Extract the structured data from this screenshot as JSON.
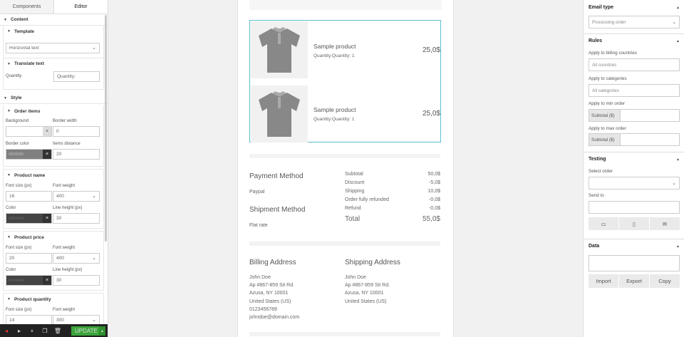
{
  "left_panel": {
    "tabs": [
      "Components",
      "Editor"
    ],
    "content_label": "Content",
    "template_label": "Template",
    "template_value": "Horizontal text",
    "translate_label": "Translate text",
    "quantity_label": "Quantity",
    "quantity_placeholder": "Quantity:",
    "style_label": "Style",
    "order_items": {
      "title": "Order items",
      "background_label": "Background",
      "border_width_label": "Border width",
      "border_width_value": "0",
      "border_color_label": "Border color",
      "border_color_value": "#808080",
      "items_distance_label": "Items distance",
      "items_distance_value": "20"
    },
    "product_name": {
      "title": "Product name",
      "font_size_label": "Font size (px)",
      "font_size_value": "16",
      "font_weight_label": "Font weight",
      "font_weight_value": "400",
      "color_label": "Color",
      "color_value": "#444444",
      "line_height_label": "Line height (px)",
      "line_height_value": "30"
    },
    "product_price": {
      "title": "Product price",
      "font_size_label": "Font size (px)",
      "font_size_value": "20",
      "font_weight_label": "Font weight",
      "font_weight_value": "400",
      "color_label": "Color",
      "color_value": "#444444",
      "line_height_label": "Line height (px)",
      "line_height_value": "30"
    },
    "product_quantity": {
      "title": "Product quantity",
      "font_size_label": "Font size (px)",
      "font_size_value": "14",
      "font_weight_label": "Font weight",
      "font_weight_value": "300"
    },
    "bottom_bar": {
      "update_label": "UPDATE"
    }
  },
  "email": {
    "items": [
      {
        "name": "Sample product",
        "qty": "Quantity:Quantity: 1",
        "price": "25,0$"
      },
      {
        "name": "Sample product",
        "qty": "Quantity:Quantity: 1",
        "price": "25,0$"
      }
    ],
    "payment_method_title": "Payment Method",
    "payment_method": "Paypal",
    "shipment_method_title": "Shipment Method",
    "shipment_method": "Flat rate",
    "totals": [
      {
        "label": "Subtotal",
        "value": "50,0$"
      },
      {
        "label": "Discount",
        "value": "-5,0$"
      },
      {
        "label": "Shipping",
        "value": "10,0$"
      },
      {
        "label": "Order fully refunded",
        "value": "-0,0$"
      },
      {
        "label": "Refund",
        "value": "-0,0$"
      }
    ],
    "total_label": "Total",
    "total_value": "55,0$",
    "billing": {
      "title": "Billing Address",
      "lines": [
        "John Doe",
        "Ap #867-859 Sit Rd.",
        "Azusa, NY 10001",
        "United States (US)",
        "0123456789",
        "johndoe@domain.com"
      ]
    },
    "shipping": {
      "title": "Shipping Address",
      "lines": [
        "John Doe",
        "Ap #867-859 Sit Rd.",
        "Azusa, NY 10001",
        "United States (US)"
      ]
    }
  },
  "right_panel": {
    "email_type_label": "Email type",
    "email_type_value": "Processing order",
    "rules_label": "Rules",
    "billing_countries_label": "Apply to billing countries",
    "billing_countries_placeholder": "All countries",
    "categories_label": "Apply to categories",
    "categories_placeholder": "All categories",
    "min_order_label": "Apply to min order",
    "min_order_prefix": "Subtotal ($)",
    "max_order_label": "Apply to max order",
    "max_order_prefix": "Subtotal ($)",
    "testing_label": "Testing",
    "select_order_label": "Select order",
    "send_to_label": "Send to",
    "data_label": "Data",
    "import_label": "Import",
    "export_label": "Export",
    "copy_label": "Copy"
  }
}
